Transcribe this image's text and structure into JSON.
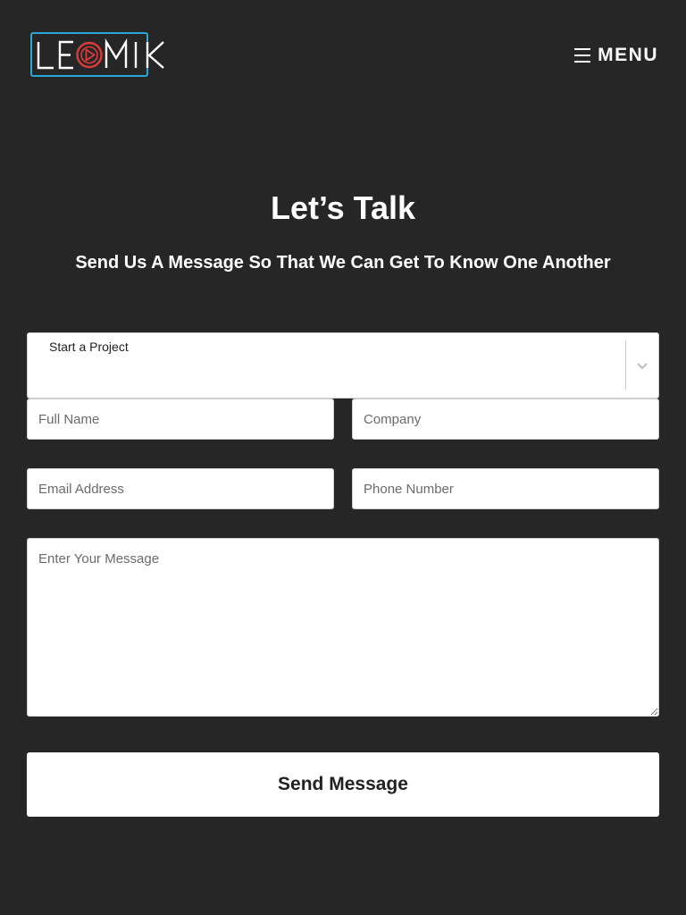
{
  "header": {
    "logo": {
      "text": "LEOMIK",
      "accent_color": "#e03a3a",
      "frame_color": "#2aa7d6",
      "icon": "play-circle-icon"
    },
    "menu": {
      "label": "MENU",
      "icon": "hamburger-icon"
    }
  },
  "main": {
    "title": "Let’s Talk",
    "subtitle": "Send Us A Message So That We Can Get To Know One Another"
  },
  "form": {
    "project_select": {
      "label": "Start a Project",
      "icon": "chevron-down-icon"
    },
    "full_name": {
      "value": "",
      "placeholder": "Full Name"
    },
    "company": {
      "value": "",
      "placeholder": "Company"
    },
    "email": {
      "value": "",
      "placeholder": "Email Address"
    },
    "phone": {
      "value": "",
      "placeholder": "Phone Number"
    },
    "message": {
      "value": "",
      "placeholder": "Enter Your Message"
    },
    "submit_label": "Send Message"
  },
  "colors": {
    "background": "#262626",
    "text": "#ffffff",
    "button_text": "#222222"
  }
}
